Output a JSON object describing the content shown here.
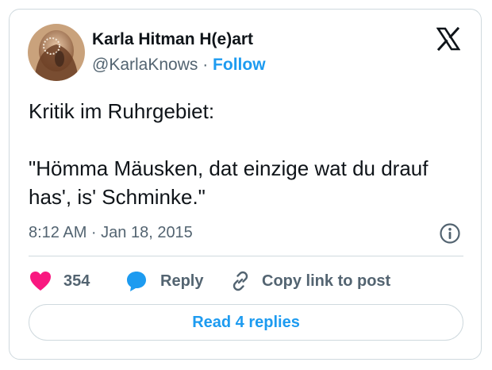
{
  "author": {
    "name": "Karla Hitman H(e)art",
    "handle": "@KarlaKnows",
    "separator": " · ",
    "follow_label": "Follow"
  },
  "tweet": {
    "lines": [
      "Kritik im Ruhrgebiet:",
      "\"Hömma Mäusken, dat einzige wat du drauf has', is' Schminke.\""
    ],
    "timestamp": "8:12 AM · Jan 18, 2015"
  },
  "actions": {
    "like_count": "354",
    "reply_label": "Reply",
    "copy_label": "Copy link to post"
  },
  "read_replies_label": "Read 4 replies",
  "colors": {
    "accent": "#1d9bf0",
    "like": "#f91880",
    "text": "#0f1419",
    "secondary": "#536471",
    "border": "#cfd9de"
  },
  "icons": [
    "x-logo-icon",
    "info-icon",
    "heart-icon",
    "reply-bubble-icon",
    "link-icon"
  ]
}
